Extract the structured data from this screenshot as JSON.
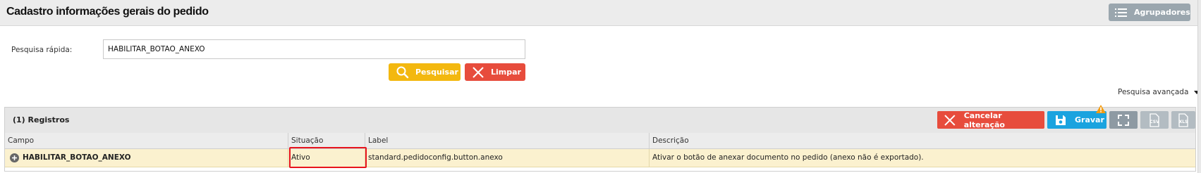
{
  "header": {
    "title": "Cadastro informações gerais do pedido",
    "agrupadores_label": "Agrupadores",
    "agrupadores_icon": "list-icon"
  },
  "search": {
    "label": "Pesquisa rápida:",
    "value": "HABILITAR_BOTAO_ANEXO",
    "pesquisar_label": "Pesquisar",
    "pesquisar_icon": "search-icon",
    "limpar_label": "Limpar",
    "limpar_icon": "close-icon",
    "advanced_label": "Pesquisa avançada"
  },
  "grid": {
    "records_label": "(1) Registros",
    "toolbar": {
      "cancelar_label": "Cancelar alteração",
      "gravar_label": "Gravar",
      "expand_icon": "fullscreen-icon",
      "csv_icon": "csv-file-icon",
      "xls_icon": "xls-file-icon",
      "warning_icon": "warning-icon"
    },
    "columns": [
      "Campo",
      "Situação",
      "Label",
      "Descrição"
    ],
    "rows": [
      {
        "campo": "HABILITAR_BOTAO_ANEXO",
        "situacao": "Ativo",
        "label": "standard.pedidoconfig.button.anexo",
        "descricao": "Ativar o botão de anexar documento no pedido (anexo não é exportado)."
      }
    ]
  },
  "colors": {
    "pesquisar": "#f3b80f",
    "limpar": "#e74c3c",
    "cancelar": "#e74c3c",
    "gravar": "#1aa3df",
    "row_highlight": "#fbf1cf",
    "annotation_box": "#e8141d"
  }
}
